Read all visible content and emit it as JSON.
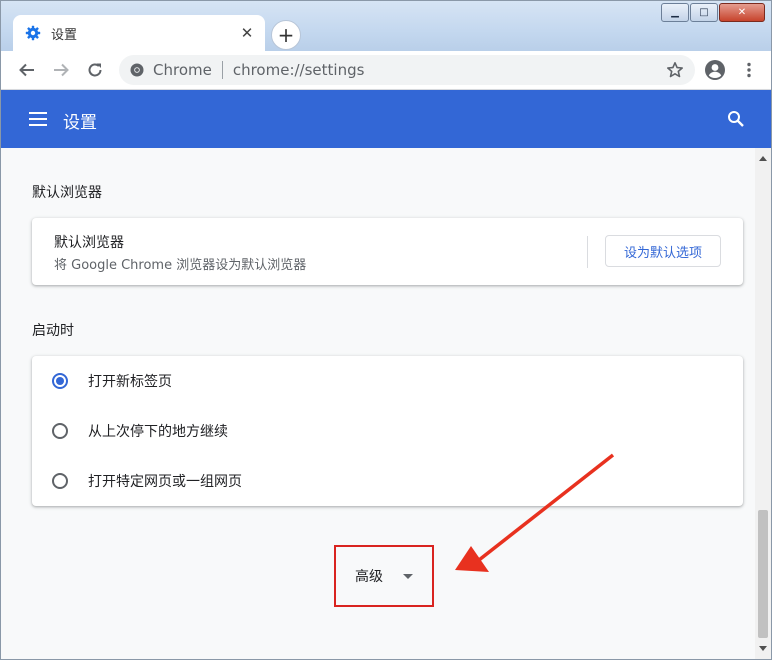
{
  "tab": {
    "title": "设置",
    "favicon": "gear-icon",
    "close_glyph": "✕"
  },
  "new_tab_glyph": "+",
  "window_controls": {
    "minimize": "▁",
    "maximize": "□",
    "close": "✕"
  },
  "toolbar": {
    "site_label": "Chrome",
    "url": "chrome://settings",
    "icons": [
      "back-icon",
      "forward-icon",
      "reload-icon",
      "star-icon",
      "account-icon",
      "more-icon"
    ]
  },
  "appbar": {
    "title": "设置",
    "accent": "#3367d6"
  },
  "default_browser": {
    "section_title": "默认浏览器",
    "label": "默认浏览器",
    "description": "将 Google Chrome 浏览器设为默认浏览器",
    "button": "设为默认选项"
  },
  "on_startup": {
    "section_title": "启动时",
    "options": [
      {
        "label": "打开新标签页",
        "checked": true
      },
      {
        "label": "从上次停下的地方继续",
        "checked": false
      },
      {
        "label": "打开特定网页或一组网页",
        "checked": false
      }
    ]
  },
  "advanced": {
    "label": "高级"
  },
  "annotation": {
    "highlight_color": "#d9231f"
  }
}
